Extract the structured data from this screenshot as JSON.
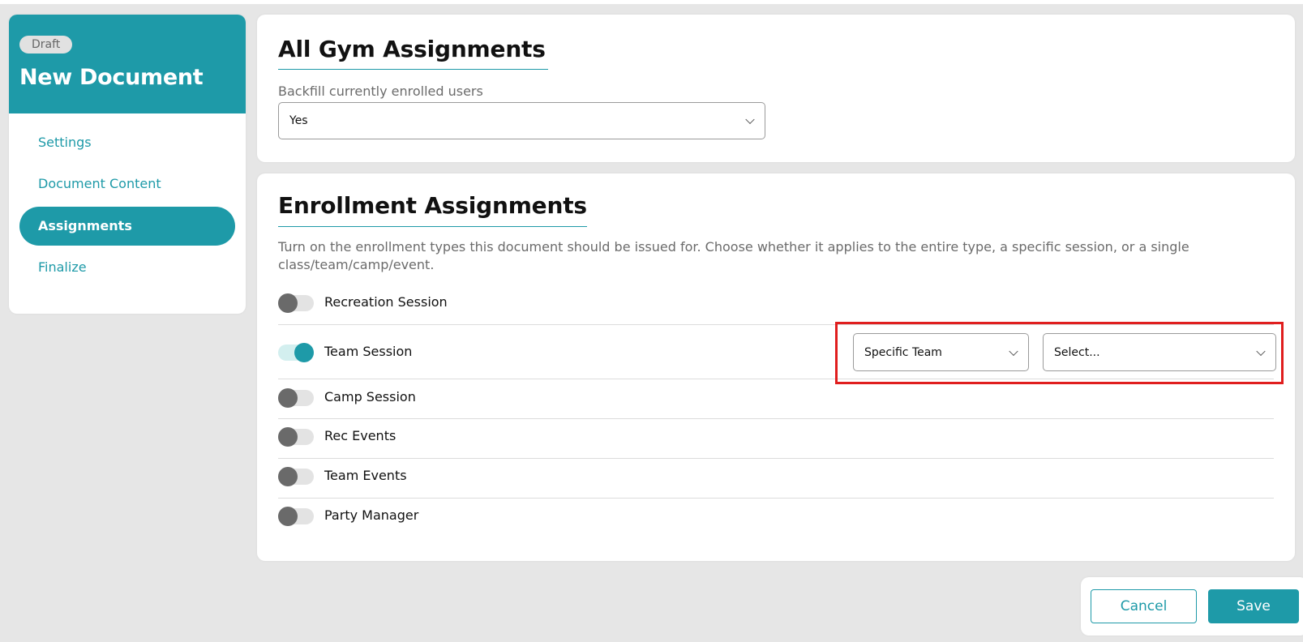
{
  "sidebar": {
    "status_badge": "Draft",
    "title": "New Document",
    "nav": [
      {
        "label": "Settings",
        "active": false
      },
      {
        "label": "Document Content",
        "active": false
      },
      {
        "label": "Assignments",
        "active": true
      },
      {
        "label": "Finalize",
        "active": false
      }
    ]
  },
  "gym_assignments": {
    "title": "All Gym Assignments",
    "backfill_label": "Backfill currently enrolled users",
    "backfill_value": "Yes"
  },
  "enrollment": {
    "title": "Enrollment Assignments",
    "description": "Turn on the enrollment types this document should be issued for. Choose whether it applies to the entire type, a specific session, or a single class/team/camp/event.",
    "types": [
      {
        "label": "Recreation Session",
        "enabled": false
      },
      {
        "label": "Team Session",
        "enabled": true,
        "scope_value": "Specific Team",
        "target_value": "Select..."
      },
      {
        "label": "Camp Session",
        "enabled": false
      },
      {
        "label": "Rec Events",
        "enabled": false
      },
      {
        "label": "Team Events",
        "enabled": false
      },
      {
        "label": "Party Manager",
        "enabled": false
      }
    ]
  },
  "footer": {
    "cancel_label": "Cancel",
    "save_label": "Save"
  },
  "colors": {
    "accent": "#1e9aa8",
    "highlight": "#e01e1e",
    "background": "#e6e6e6"
  }
}
